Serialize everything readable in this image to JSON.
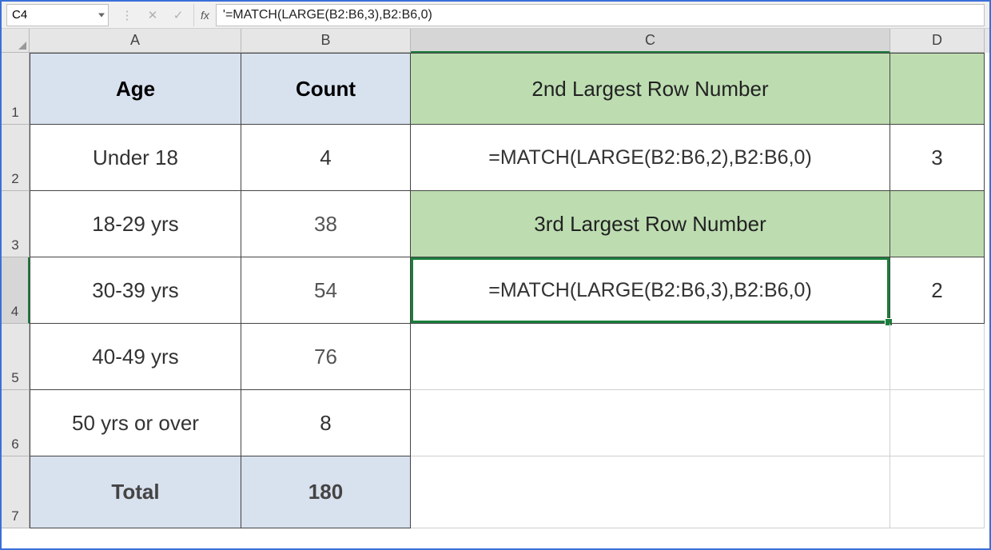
{
  "formula_bar": {
    "cell_ref": "C4",
    "fx_label": "fx",
    "formula_text": "'=MATCH(LARGE(B2:B6,3),B2:B6,0)"
  },
  "columns": {
    "a": "A",
    "b": "B",
    "c": "C",
    "d": "D"
  },
  "row_nums": {
    "r1": "1",
    "r2": "2",
    "r3": "3",
    "r4": "4",
    "r5": "5",
    "r6": "6",
    "r7": "7"
  },
  "headers": {
    "age": "Age",
    "count": "Count"
  },
  "data": {
    "r2": {
      "age": "Under 18",
      "count": "4"
    },
    "r3": {
      "age": "18-29 yrs",
      "count": "38"
    },
    "r4": {
      "age": "30-39 yrs",
      "count": "54"
    },
    "r5": {
      "age": "40-49 yrs",
      "count": "76"
    },
    "r6": {
      "age": "50 yrs or over",
      "count": "8"
    }
  },
  "total": {
    "label": "Total",
    "value": "180"
  },
  "right": {
    "c1_label": "2nd Largest Row Number",
    "c2_formula": "=MATCH(LARGE(B2:B6,2),B2:B6,0)",
    "d2_value": "3",
    "c3_label": "3rd Largest Row Number",
    "c4_formula": "=MATCH(LARGE(B2:B6,3),B2:B6,0)",
    "d4_value": "2"
  }
}
